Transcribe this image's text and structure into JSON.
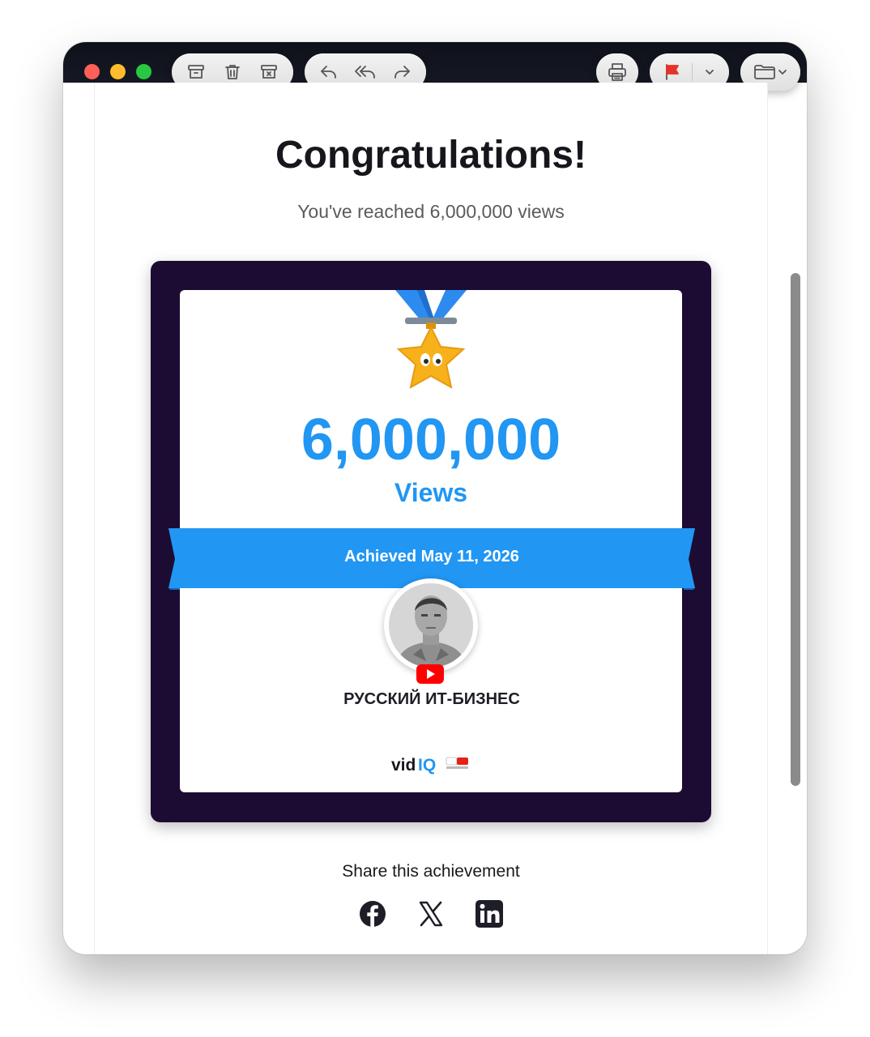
{
  "window": {
    "toolbar": {
      "icons": [
        "archive-icon",
        "trash-icon",
        "junk-icon",
        "reply-icon",
        "reply-all-icon",
        "forward-icon",
        "print-icon",
        "flag-icon",
        "chevron-down-icon",
        "folder-icon"
      ],
      "flag_color": "#e5332a"
    }
  },
  "email": {
    "heading": "Congratulations!",
    "subtitle": "You've reached 6,000,000 views",
    "card": {
      "milestone": "6,000,000",
      "metric": "Views",
      "achieved": "Achieved May 11, 2026",
      "channel_name": "РУССКИЙ ИТ-БИЗНЕС",
      "brand": "vidIQ",
      "accent_color": "#2196f3",
      "frame_color": "#1c0c33"
    },
    "share": {
      "title": "Share this achievement",
      "networks": [
        "facebook-icon",
        "x-icon",
        "linkedin-icon"
      ]
    }
  }
}
